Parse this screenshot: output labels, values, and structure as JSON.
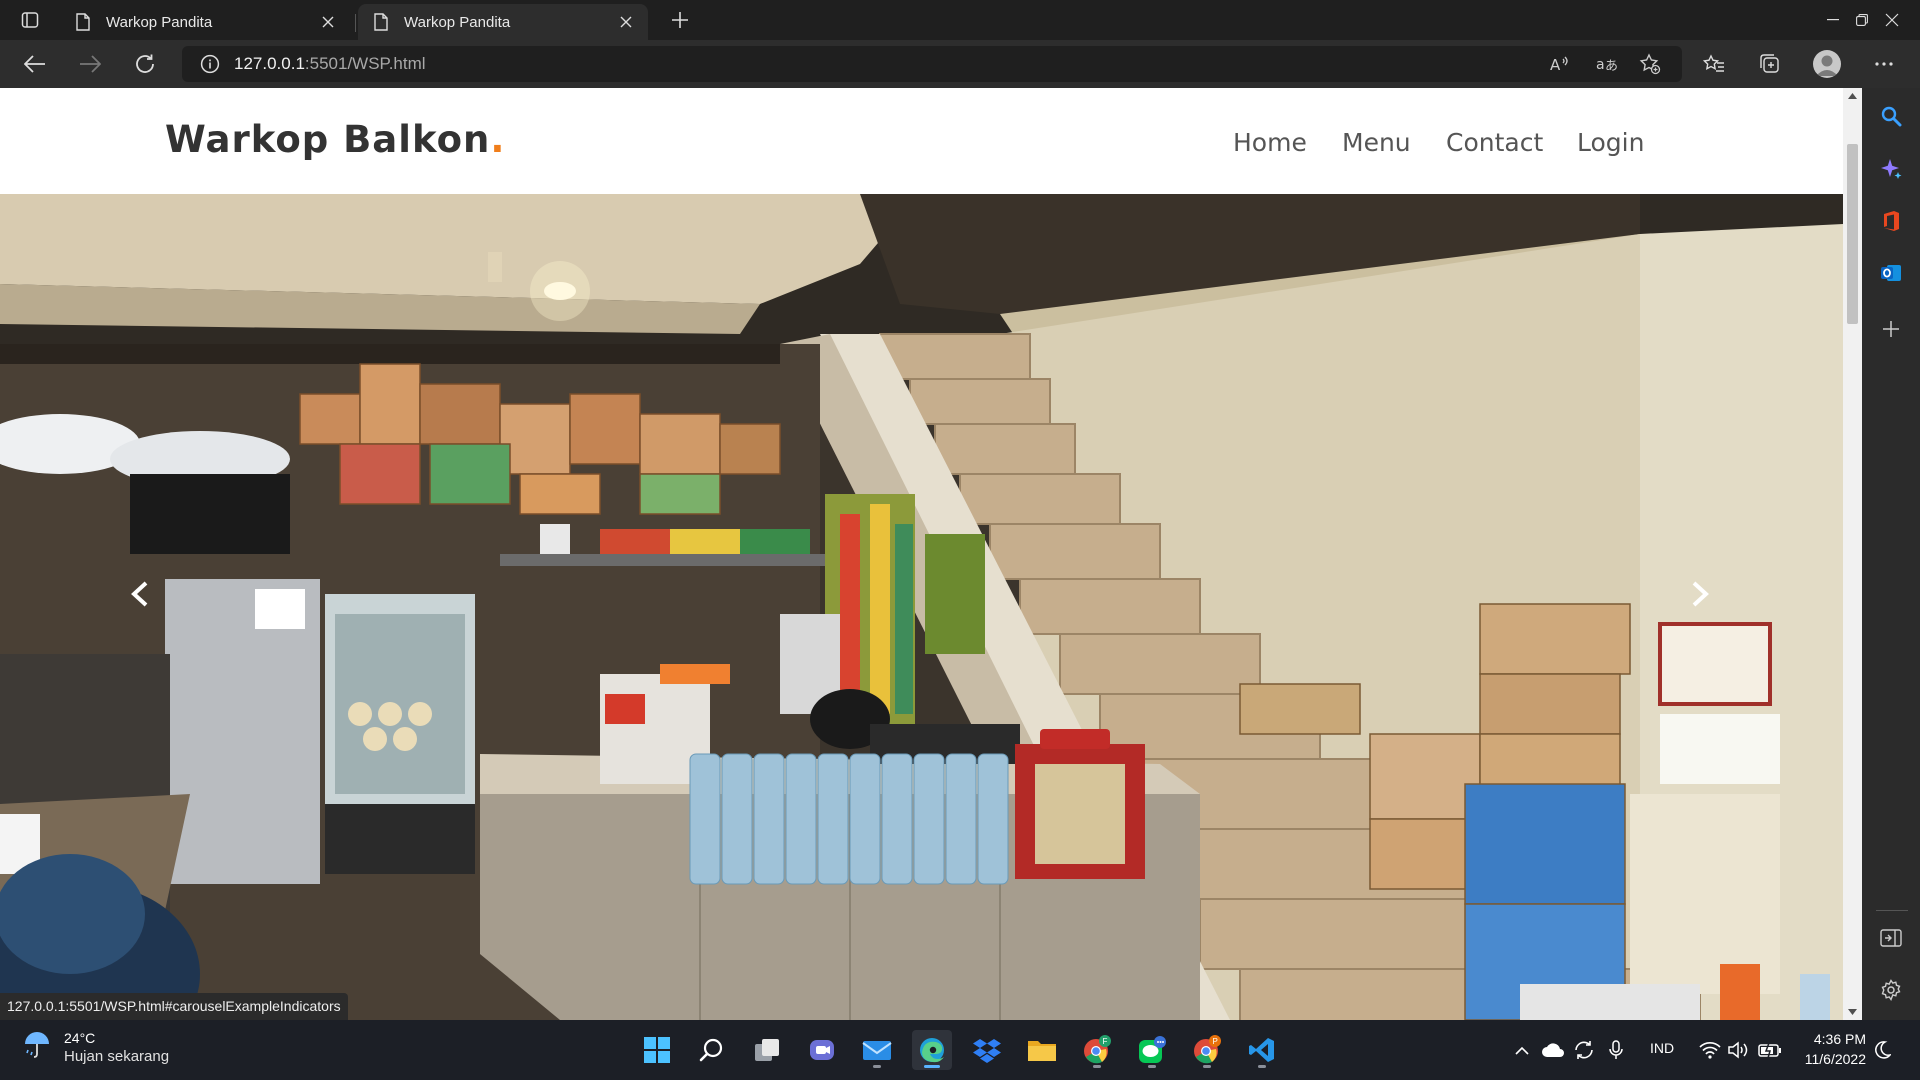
{
  "browser": {
    "tabs": [
      {
        "title": "Warkop Pandita",
        "active": false
      },
      {
        "title": "Warkop Pandita",
        "active": true
      }
    ],
    "address": {
      "host": "127.0.0.1",
      "path": ":5501/WSP.html"
    },
    "status_url": "127.0.0.1:5501/WSP.html#carouselExampleIndicators"
  },
  "site": {
    "brand": "Warkop Balkon",
    "brand_dot": ".",
    "brand_dot_color": "#f07e1b",
    "nav": [
      {
        "label": "Home"
      },
      {
        "label": "Menu"
      },
      {
        "label": "Contact"
      },
      {
        "label": "Login"
      }
    ],
    "carousel": {
      "slide_description_icon": "warung-interior-photo",
      "prev_icon": "chevron-left-icon",
      "next_icon": "chevron-right-icon"
    }
  },
  "taskbar": {
    "weather": {
      "temp": "24°C",
      "desc": "Hujan sekarang"
    },
    "lang": "IND",
    "time": "4:36 PM",
    "date": "11/6/2022"
  },
  "colors": {
    "edge_accent": "#0a84ff",
    "taskbar_bg": "#1c1f26",
    "browser_bg": "#2d2d2d"
  }
}
